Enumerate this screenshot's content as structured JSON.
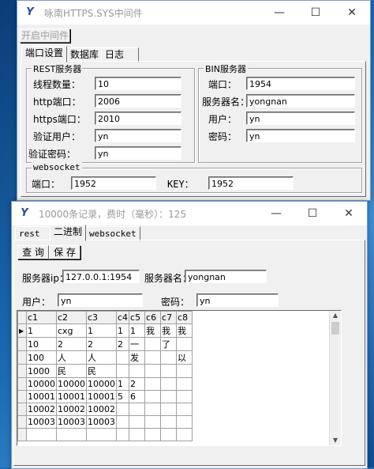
{
  "win1": {
    "title": "咏南HTTPS.SYS中间件",
    "start_button": "开启中间件",
    "tabs": [
      "端口设置",
      "数据库",
      "日志"
    ],
    "rest": {
      "title": "REST服务器",
      "threads_label": "线程数量：",
      "threads": "10",
      "http_label": "http端口：",
      "http": "2006",
      "https_label": "https端口：",
      "https": "2010",
      "user_label": "验证用户：",
      "user": "yn",
      "pwd_label": "验证密码：",
      "pwd": "yn"
    },
    "bin": {
      "title": "BIN服务器",
      "port_label": "端口：",
      "port": "1954",
      "name_label": "服务器名：",
      "name": "yongnan",
      "user_label": "用户：",
      "user": "yn",
      "pwd_label": "密码：",
      "pwd": "yn"
    },
    "ws": {
      "title": "websocket",
      "port_label": "端口：",
      "port": "1952",
      "key_label": "KEY：",
      "key": "1952"
    }
  },
  "win2": {
    "title": "10000条记录，费时（毫秒）：125",
    "tabs": [
      "rest",
      "二进制",
      "websocket"
    ],
    "query_button": "查 询",
    "save_button": "保 存",
    "ip_label": "服务器ip：",
    "ip": "127.0.0.1:1954",
    "name_label": "服务器名：",
    "name": "yongnan",
    "user_label": "用户：",
    "user": "yn",
    "pwd_label": "密码：",
    "pwd": "yn",
    "columns": [
      "c1",
      "c2",
      "c3",
      "c4",
      "c5",
      "c6",
      "c7",
      "c8"
    ],
    "rows": [
      [
        "1",
        "cxg",
        "1",
        "1",
        "1",
        "我",
        "我",
        "我"
      ],
      [
        "10",
        "2",
        "2",
        "2",
        "一",
        "",
        "了",
        ""
      ],
      [
        "100",
        "人",
        "人",
        "",
        "发",
        "",
        "",
        "以"
      ],
      [
        "1000",
        "民",
        "民",
        "",
        "",
        "",
        "",
        ""
      ],
      [
        "10000",
        "10000",
        "10000",
        "1",
        "2",
        "",
        "",
        ""
      ],
      [
        "10001",
        "10001",
        "10001",
        "5",
        "6",
        "",
        "",
        ""
      ],
      [
        "10002",
        "10002",
        "10002",
        "",
        "",
        "",
        "",
        ""
      ],
      [
        "10003",
        "10003",
        "10003",
        "",
        "",
        "",
        "",
        ""
      ]
    ]
  }
}
